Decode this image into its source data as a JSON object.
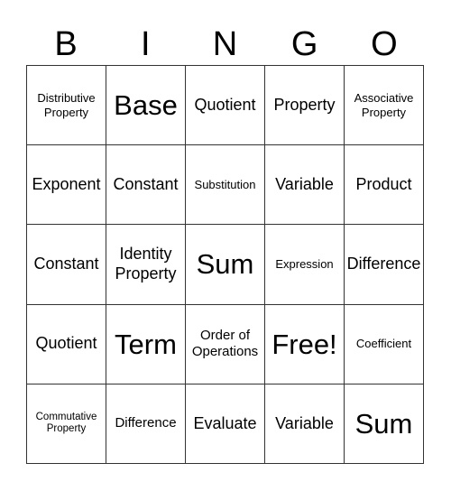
{
  "header": [
    "B",
    "I",
    "N",
    "G",
    "O"
  ],
  "cells": [
    [
      "Distributive Property",
      "Base",
      "Quotient",
      "Property",
      "Associative Property"
    ],
    [
      "Exponent",
      "Constant",
      "Substitution",
      "Variable",
      "Product"
    ],
    [
      "Constant",
      "Identity Property",
      "Sum",
      "Expression",
      "Difference"
    ],
    [
      "Quotient",
      "Term",
      "Order of Operations",
      "Free!",
      "Coefficient"
    ],
    [
      "Commutative Property",
      "Difference",
      "Evaluate",
      "Variable",
      "Sum"
    ]
  ]
}
